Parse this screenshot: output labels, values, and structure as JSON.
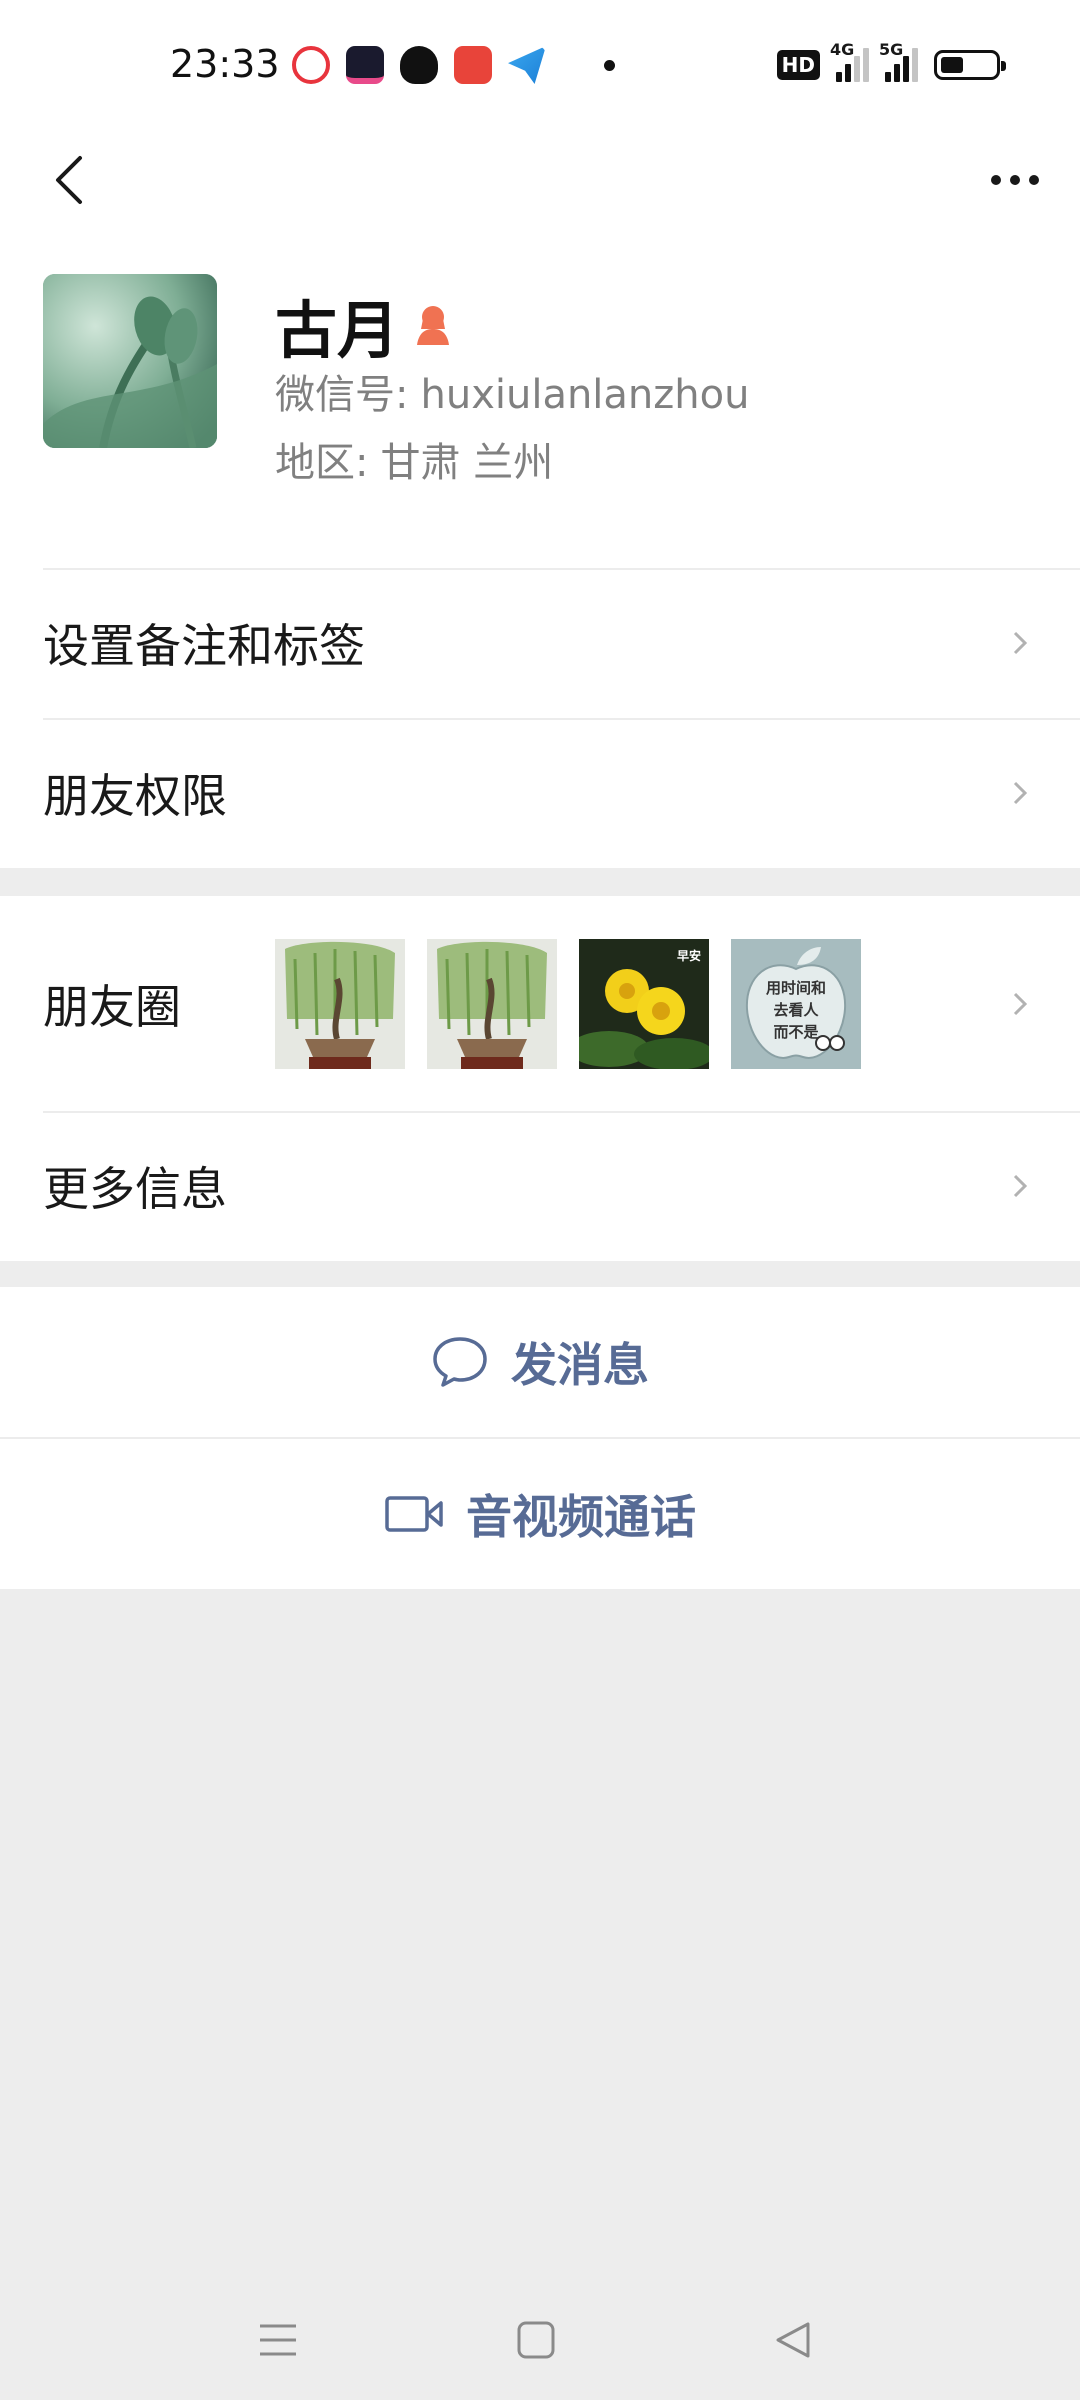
{
  "status_bar": {
    "time": "23:33",
    "app_icons": [
      "video-app-icon",
      "tiktok-icon",
      "butterfly-app-icon",
      "heart-app-icon",
      "telegram-icon"
    ],
    "hd_label": "HD",
    "network_1": "4G",
    "network_2": "5G",
    "battery_percent": 35
  },
  "nav": {
    "back_icon": "chevron-left-icon",
    "more_icon": "ellipsis-icon"
  },
  "profile": {
    "name": "古月",
    "gender_icon": "female-icon",
    "id_label": "微信号:",
    "id_value": "huxiulanlanzhou",
    "region_label": "地区:",
    "region_value": "甘肃  兰州"
  },
  "menu": {
    "remark_tags": "设置备注和标签",
    "friend_permissions": "朋友权限",
    "moments": "朋友圈",
    "more_info": "更多信息"
  },
  "moments_thumbs": [
    {
      "name": "willow-bonsai-photo"
    },
    {
      "name": "willow-bonsai-photo"
    },
    {
      "name": "yellow-flower-photo",
      "caption_top": "早安"
    },
    {
      "name": "apple-logo-photo",
      "caption_lines": [
        "用时间和",
        "去看人",
        "而不是"
      ]
    }
  ],
  "actions": {
    "send_message": "发消息",
    "video_call": "音视频通话"
  },
  "colors": {
    "accent": "#576b95",
    "background": "#ededed",
    "gender_icon": "#f07252"
  }
}
